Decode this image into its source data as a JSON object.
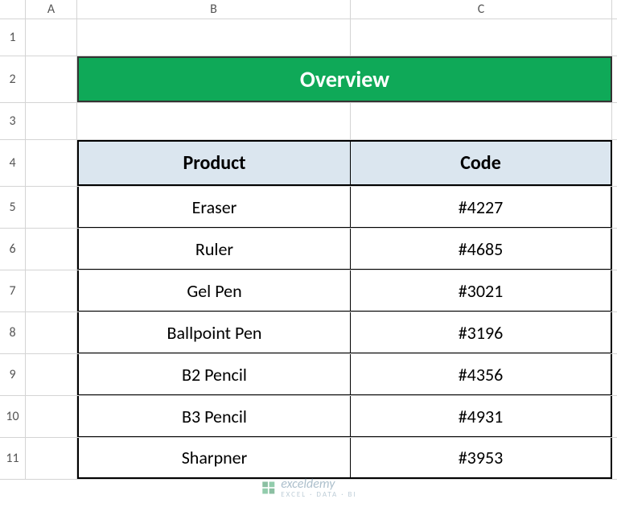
{
  "columns": {
    "A": "A",
    "B": "B",
    "C": "C"
  },
  "rows": {
    "r1": "1",
    "r2": "2",
    "r3": "3",
    "r4": "4",
    "r5": "5",
    "r6": "6",
    "r7": "7",
    "r8": "8",
    "r9": "9",
    "r10": "10",
    "r11": "11"
  },
  "title": "Overview",
  "table": {
    "headers": {
      "product": "Product",
      "code": "Code"
    },
    "rows": [
      {
        "product": "Eraser",
        "code": "#4227"
      },
      {
        "product": "Ruler",
        "code": "#4685"
      },
      {
        "product": "Gel Pen",
        "code": "#3021"
      },
      {
        "product": "Ballpoint Pen",
        "code": "#3196"
      },
      {
        "product": "B2 Pencil",
        "code": "#4356"
      },
      {
        "product": "B3 Pencil",
        "code": "#4931"
      },
      {
        "product": "Sharpner",
        "code": "#3953"
      }
    ]
  },
  "watermark": {
    "name": "exceldemy",
    "sub": "EXCEL · DATA · BI"
  },
  "chart_data": {
    "type": "table",
    "title": "Overview",
    "columns": [
      "Product",
      "Code"
    ],
    "rows": [
      [
        "Eraser",
        "#4227"
      ],
      [
        "Ruler",
        "#4685"
      ],
      [
        "Gel Pen",
        "#3021"
      ],
      [
        "Ballpoint Pen",
        "#3196"
      ],
      [
        "B2 Pencil",
        "#4356"
      ],
      [
        "B3 Pencil",
        "#4931"
      ],
      [
        "Sharpner",
        "#3953"
      ]
    ]
  }
}
